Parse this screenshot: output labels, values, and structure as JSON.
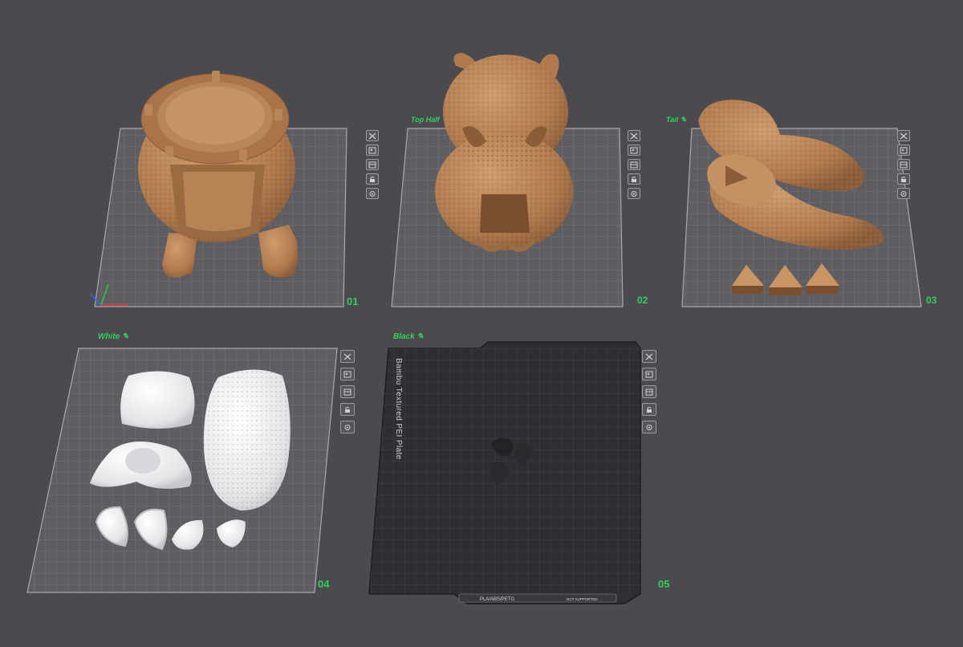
{
  "plates": [
    {
      "id": "plate-01",
      "name": "",
      "number": "01"
    },
    {
      "id": "plate-02",
      "name": "Top Half",
      "number": "02"
    },
    {
      "id": "plate-03",
      "name": "Tail ✎",
      "number": "03"
    },
    {
      "id": "plate-04",
      "name": "White ✎",
      "number": "04"
    },
    {
      "id": "plate-05",
      "name": "Black ✎",
      "number": "05"
    }
  ],
  "plate05": {
    "bed_label": "Bambu Textured PEI Plate",
    "footer_filament": "PLA/ABS/PETG",
    "footer_side": "NOT SUPPORTED"
  },
  "toolbar_icons": [
    "close-icon",
    "arrange-icon",
    "orient-icon",
    "lock-icon",
    "settings-icon"
  ],
  "colors": {
    "background": "#4b4b4f",
    "plate_grid": "#a9a9ad",
    "plate_dark": "#2f2f33",
    "model_tan": "#b98659",
    "model_white": "#f2f2f2",
    "model_black": "#2b2b2e",
    "label_green": "#2fd15a"
  }
}
